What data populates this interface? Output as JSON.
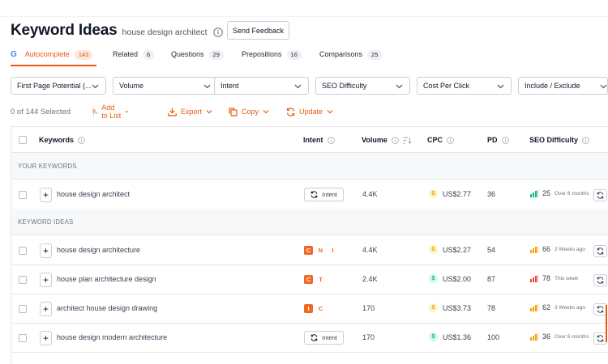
{
  "header": {
    "title": "Keyword Ideas",
    "seed_keyword": "house design architect",
    "feedback_label": "Send Feedback"
  },
  "tabs": [
    {
      "label": "Autocomplete",
      "count": "143",
      "active": true
    },
    {
      "label": "Related",
      "count": "6"
    },
    {
      "label": "Questions",
      "count": "29"
    },
    {
      "label": "Prepositions",
      "count": "16"
    },
    {
      "label": "Comparisons",
      "count": "25"
    }
  ],
  "google_logo": "G",
  "filters": [
    {
      "label": "First Page Potential (..."
    },
    {
      "label": "Volume"
    },
    {
      "label": "Intent"
    },
    {
      "label": "SEO Difficulty"
    },
    {
      "label": "Cost Per Click"
    },
    {
      "label": "Include / Exclude"
    }
  ],
  "toolbar": {
    "selected": "0 of 144 Selected",
    "add_to_list": "Add to List",
    "export": "Export",
    "copy": "Copy",
    "update": "Update"
  },
  "columns": {
    "keywords": "Keywords",
    "intent": "Intent",
    "volume": "Volume",
    "cpc": "CPC",
    "pd": "PD",
    "seo_difficulty": "SEO Difficulty"
  },
  "sections": {
    "your_keywords": "YOUR KEYWORDS",
    "keyword_ideas": "KEYWORD IDEAS"
  },
  "intent_button_label": "Intent",
  "colors": {
    "accent": "#e8590c",
    "cpc_orange": "#f59e0b",
    "cpc_green": "#10b981",
    "difficulty_green": "#10b981",
    "difficulty_orange": "#f59e0b",
    "difficulty_red": "#ef4444"
  },
  "rows": [
    {
      "keyword": "house design architect",
      "intent": "button",
      "volume": "4.4K",
      "cpc": "US$2.77",
      "cpc_color": "orange",
      "pd": "36",
      "sd": "25",
      "sd_color": "green",
      "ago": "Over 6 months"
    },
    {
      "keyword": "house design architecture",
      "intent": [
        "C",
        "N",
        "I"
      ],
      "volume": "4.4K",
      "cpc": "US$2.27",
      "cpc_color": "orange",
      "pd": "54",
      "sd": "66",
      "sd_color": "orange",
      "ago": "2 Weeks ago"
    },
    {
      "keyword": "house plan architecture design",
      "intent": [
        "C",
        "T"
      ],
      "volume": "2.4K",
      "cpc": "US$2.00",
      "cpc_color": "green",
      "pd": "87",
      "sd": "78",
      "sd_color": "red",
      "ago": "This week"
    },
    {
      "keyword": "architect house design drawing",
      "intent": [
        "I",
        "C"
      ],
      "volume": "170",
      "cpc": "US$3.73",
      "cpc_color": "orange",
      "pd": "78",
      "sd": "62",
      "sd_color": "orange",
      "ago": "3 Weeks ago"
    },
    {
      "keyword": "house design modern architecture",
      "intent": "button",
      "volume": "170",
      "cpc": "US$1.36",
      "cpc_color": "green",
      "pd": "100",
      "sd": "36",
      "sd_color": "orange",
      "ago": "Over 6 months"
    }
  ]
}
